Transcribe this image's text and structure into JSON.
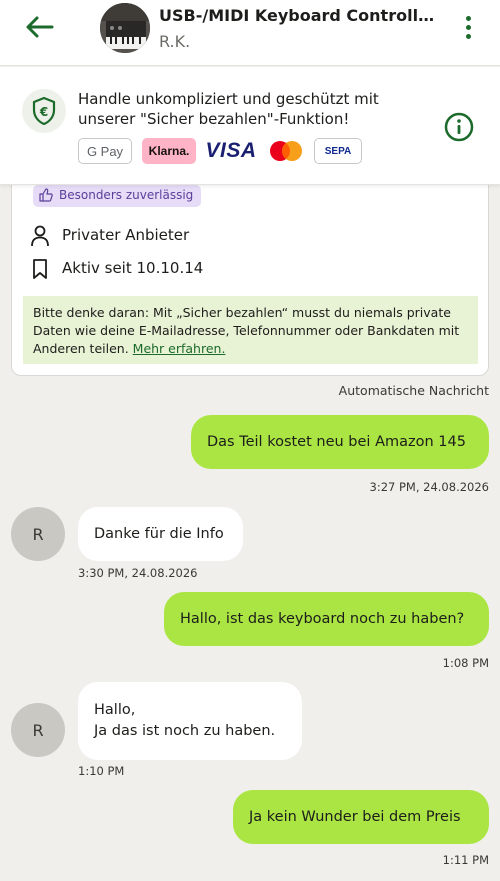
{
  "header": {
    "title": "USB-/MIDI Keyboard Controller N...",
    "seller": "R.K.",
    "back_icon": "arrow-left-icon",
    "more_icon": "more-vertical-icon"
  },
  "banner": {
    "text": "Handle unkompliziert und geschützt mit unserer \"Sicher bezahlen\"-Funktion!",
    "payment_methods": [
      "G Pay",
      "Klarna.",
      "VISA",
      "Mastercard",
      "SEPA"
    ],
    "info_icon": "info-icon"
  },
  "profile_card": {
    "badge": "Besonders zuverlässig",
    "seller_type": "Privater Anbieter",
    "active_since": "Aktiv seit 10.10.14",
    "notice_text": "Bitte denke daran: Mit „Sicher bezahlen“ musst du niemals private Daten wie deine E-Mailadresse, Telefonnummer oder Bankdaten mit Anderen teilen. ",
    "notice_link": "Mehr erfahren."
  },
  "auto_message_label": "Automatische Nachricht",
  "messages": [
    {
      "from": "me",
      "text": "Das Teil kostet neu bei Amazon 145",
      "time": "3:27 PM, 24.08.2026"
    },
    {
      "from": "them",
      "avatar": "R",
      "text": "Danke für die Info",
      "time": "3:30 PM, 24.08.2026"
    },
    {
      "from": "me",
      "text": "Hallo, ist das keyboard noch zu haben?",
      "time": "1:08 PM"
    },
    {
      "from": "them",
      "avatar": "R",
      "text_line1": "Hallo,",
      "text_line2": "Ja das ist noch zu haben.",
      "time": "1:10 PM"
    },
    {
      "from": "me",
      "text": "Ja kein Wunder bei dem Preis",
      "time": "1:11 PM"
    }
  ],
  "colors": {
    "accent_green": "#1c6b2c",
    "bubble_out": "#aae543",
    "notice_bg": "#e8f2d4",
    "badge_bg": "#e6dcf7"
  }
}
